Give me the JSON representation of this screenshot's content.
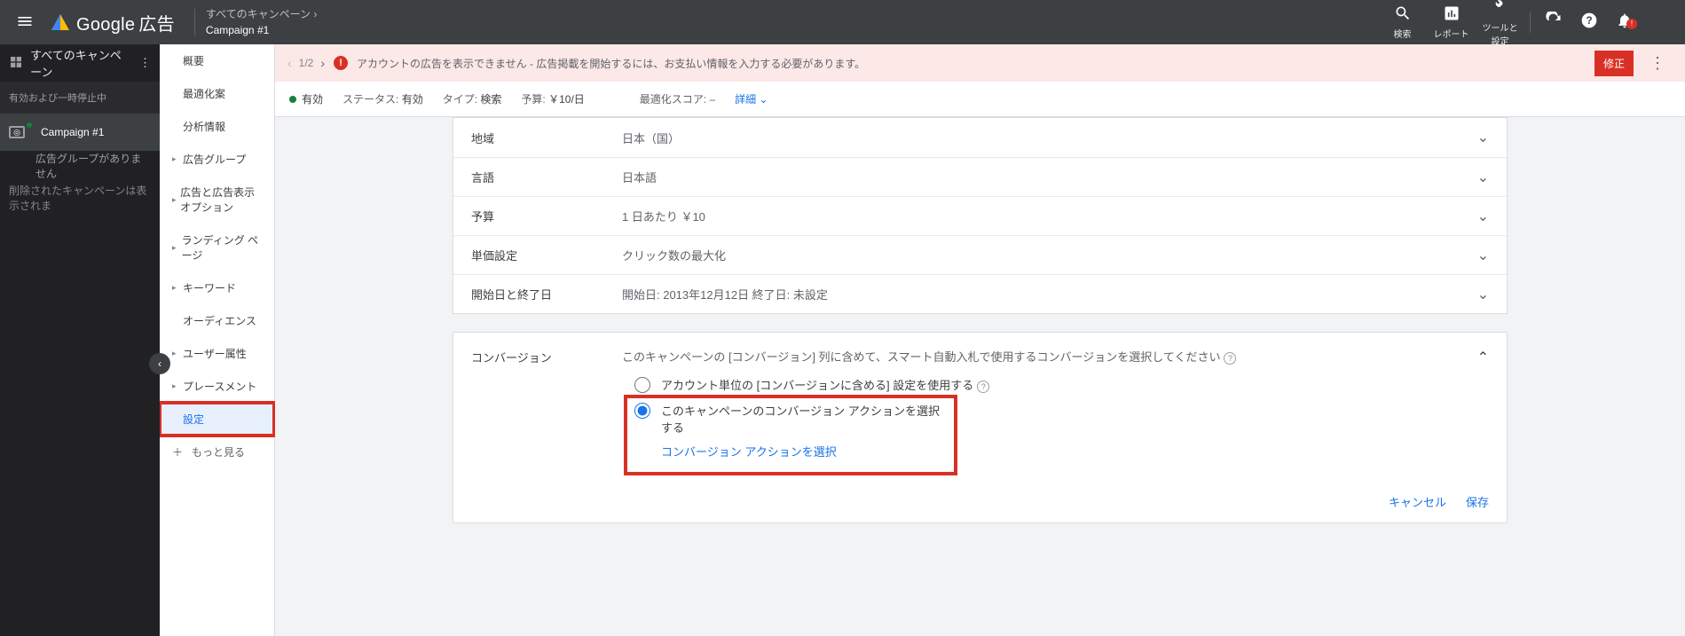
{
  "topbar": {
    "brand_google": "Google",
    "brand_ads": "広告",
    "breadcrumb_line1": "すべてのキャンペーン  ›",
    "breadcrumb_line2": "Campaign #1",
    "tools": {
      "search": "検索",
      "report": "レポート",
      "tools_settings": "ツールと\n設定"
    },
    "bell_count": "!"
  },
  "sidebar1": {
    "all_campaigns": "すべてのキャンペーン",
    "filter_line": "有効および一時停止中",
    "campaign_name": "Campaign #1",
    "no_adgroup": "広告グループがありません",
    "deleted_note": "削除されたキャンペーンは表示されま"
  },
  "sidebar2": {
    "items": [
      {
        "label": "概要",
        "arrow": false
      },
      {
        "label": "最適化案",
        "arrow": false
      },
      {
        "label": "分析情報",
        "arrow": false
      },
      {
        "label": "広告グループ",
        "arrow": true
      },
      {
        "label": "広告と広告表示オプション",
        "arrow": true
      },
      {
        "label": "ランディング ページ",
        "arrow": true
      },
      {
        "label": "キーワード",
        "arrow": true
      },
      {
        "label": "オーディエンス",
        "arrow": false
      },
      {
        "label": "ユーザー属性",
        "arrow": true
      },
      {
        "label": "プレースメント",
        "arrow": true
      },
      {
        "label": "設定",
        "arrow": false,
        "selected": true
      },
      {
        "label": "もっと見る",
        "arrow": false,
        "more": true
      }
    ]
  },
  "alert": {
    "page": "1/2",
    "text": "アカウントの広告を表示できません - 広告掲載を開始するには、お支払い情報を入力する必要があります。",
    "fix": "修正"
  },
  "status": {
    "enabled": "有効",
    "status_label": "ステータス:",
    "status_value": "有効",
    "type_label": "タイプ:",
    "type_value": "検索",
    "budget_label": "予算:",
    "budget_value": "￥10/日",
    "opt_label": "最適化スコア: –",
    "detail": "詳細"
  },
  "settings_rows": [
    {
      "label": "地域",
      "value": "日本（国）"
    },
    {
      "label": "言語",
      "value": "日本語"
    },
    {
      "label": "予算",
      "value": "1 日あたり  ￥10"
    },
    {
      "label": "単価設定",
      "value": "クリック数の最大化"
    },
    {
      "label": "開始日と終了日",
      "value": "開始日: 2013年12月12日        終了日: 未設定"
    }
  ],
  "conversion": {
    "label": "コンバージョン",
    "desc": "このキャンペーンの [コンバージョン] 列に含めて、スマート自動入札で使用するコンバージョンを選択してください",
    "opt1": "アカウント単位の [コンバージョンに含める] 設定を使用する",
    "opt2": "このキャンペーンのコンバージョン アクションを選択する",
    "opt2_link": "コンバージョン アクションを選択",
    "cancel": "キャンセル",
    "save": "保存"
  }
}
